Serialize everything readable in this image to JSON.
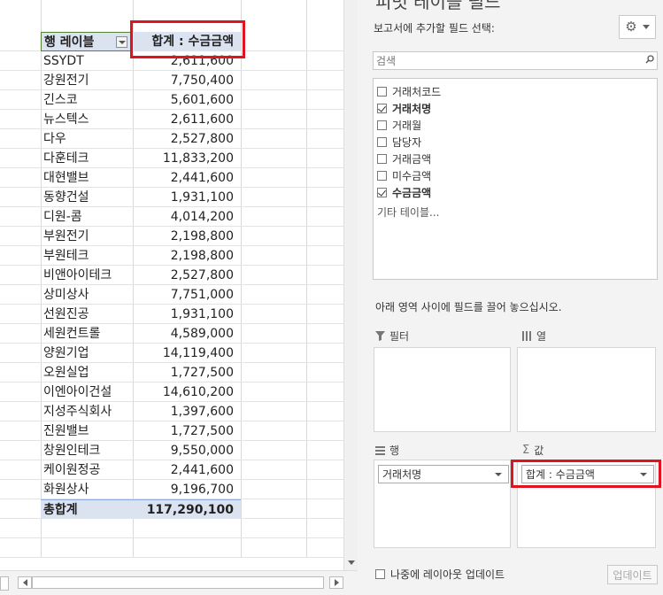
{
  "pivot_table": {
    "header": {
      "row_label": "행 레이블",
      "value_label": "합계 : 수금금액"
    },
    "rows": [
      {
        "name": "SSYDT",
        "value": "2,611,600"
      },
      {
        "name": "강원전기",
        "value": "7,750,400"
      },
      {
        "name": "긴스코",
        "value": "5,601,600"
      },
      {
        "name": "뉴스텍스",
        "value": "2,611,600"
      },
      {
        "name": "다우",
        "value": "2,527,800"
      },
      {
        "name": "다훈테크",
        "value": "11,833,200"
      },
      {
        "name": "대현밸브",
        "value": "2,441,600"
      },
      {
        "name": "동향건설",
        "value": "1,931,100"
      },
      {
        "name": "디원-콤",
        "value": "4,014,200"
      },
      {
        "name": "부원전기",
        "value": "2,198,800"
      },
      {
        "name": "부원테크",
        "value": "2,198,800"
      },
      {
        "name": "비앤아이테크",
        "value": "2,527,800"
      },
      {
        "name": "상미상사",
        "value": "7,751,000"
      },
      {
        "name": "선원진공",
        "value": "1,931,100"
      },
      {
        "name": "세원컨트롤",
        "value": "4,589,000"
      },
      {
        "name": "양원기업",
        "value": "14,119,400"
      },
      {
        "name": "오원실업",
        "value": "1,727,500"
      },
      {
        "name": "이엔아이건설",
        "value": "14,610,200"
      },
      {
        "name": "지성주식회사",
        "value": "1,397,600"
      },
      {
        "name": "진원밸브",
        "value": "1,727,500"
      },
      {
        "name": "창원인테크",
        "value": "9,550,000"
      },
      {
        "name": "케이원정공",
        "value": "2,441,600"
      },
      {
        "name": "화원상사",
        "value": "9,196,700"
      }
    ],
    "total": {
      "label": "총합계",
      "value": "117,290,100"
    }
  },
  "field_pane": {
    "title": "피벗 테이블 필드",
    "prompt": "보고서에 추가할 필드 선택:",
    "search_placeholder": "검색",
    "fields": [
      {
        "label": "거래처코드",
        "checked": false
      },
      {
        "label": "거래처명",
        "checked": true
      },
      {
        "label": "거래월",
        "checked": false
      },
      {
        "label": "담당자",
        "checked": false
      },
      {
        "label": "거래금액",
        "checked": false
      },
      {
        "label": "미수금액",
        "checked": false
      },
      {
        "label": "수금금액",
        "checked": true
      }
    ],
    "more_tables": "기타 테이블...",
    "drag_hint": "아래 영역 사이에 필드를 끌어 놓으십시오.",
    "areas": {
      "filter": {
        "label": "필터",
        "items": []
      },
      "columns": {
        "label": "열",
        "items": []
      },
      "rows": {
        "label": "행",
        "items": [
          "거래처명"
        ]
      },
      "values": {
        "label": "값",
        "items": [
          "합계 : 수금금액"
        ]
      }
    },
    "defer_label": "나중에 레이아웃 업데이트",
    "update_label": "업데이트"
  },
  "colors": {
    "highlight": "#e0141e",
    "header_fill": "#dbe3f1"
  }
}
